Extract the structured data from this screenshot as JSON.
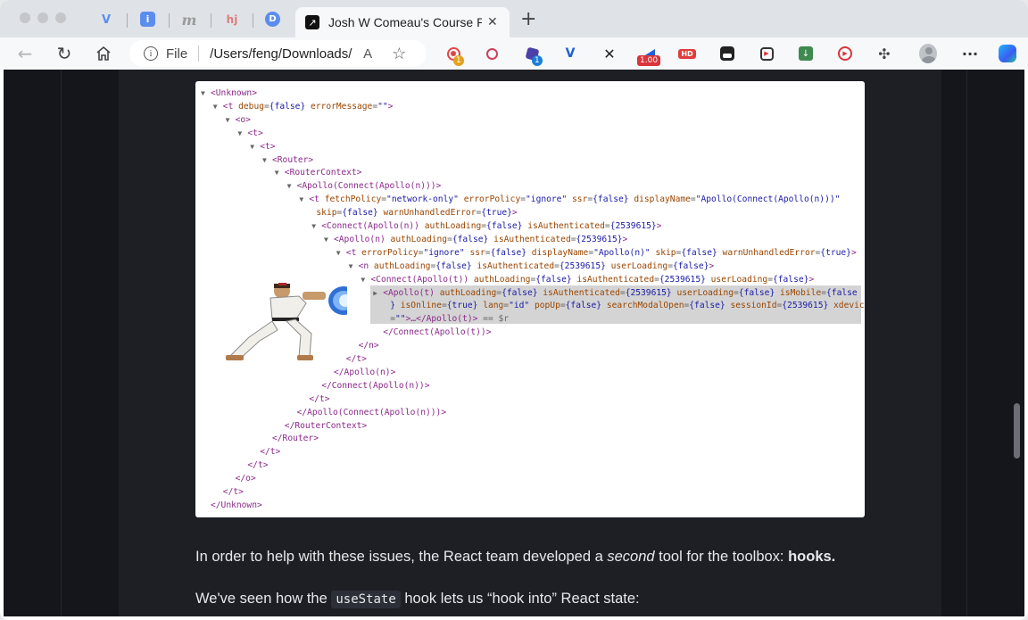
{
  "tabs": {
    "pinned": [
      {
        "icon": "vue-icon",
        "glyph": "V",
        "color": "#5b8def"
      },
      {
        "icon": "info-icon",
        "glyph": "i",
        "color": "#5b8def"
      },
      {
        "icon": "m-icon",
        "glyph": "m",
        "color": "#9a9a9a"
      },
      {
        "icon": "hj-icon",
        "glyph": "hj",
        "color": "#e07a7a"
      },
      {
        "icon": "play-d-icon",
        "glyph": "D",
        "color": "#5b8def"
      }
    ],
    "active": {
      "title": "Josh W Comeau's Course Platform",
      "close": "✕",
      "favicon": "↗"
    },
    "new_tab": "+"
  },
  "toolbar": {
    "back": "←",
    "refresh": "↻",
    "home": "⌂",
    "omnibox": {
      "scheme": "File",
      "url": "/Users/feng/Downloads/",
      "info": "i"
    },
    "read_aloud": "A",
    "favorite": "☆",
    "ext_badges": {
      "first": "1",
      "purple": "1",
      "speed": "1.00"
    },
    "ext_hd": "HD",
    "more": "···"
  },
  "colors": {
    "accent": "#1a73e8",
    "page_bg": "#15161b",
    "content_bg": "#1d1f25"
  },
  "code_lines": [
    {
      "i": 0,
      "arrow": "▼",
      "parts": [
        [
          "tg",
          "<Unknown>"
        ]
      ]
    },
    {
      "i": 1,
      "arrow": "▼",
      "parts": [
        [
          "tg",
          "<t "
        ],
        [
          "at",
          "debug"
        ],
        [
          "ar",
          "="
        ],
        [
          "vl",
          "{false}"
        ],
        [
          "ar",
          " "
        ],
        [
          "at",
          "errorMessage"
        ],
        [
          "ar",
          "="
        ],
        [
          "vl",
          "\"\""
        ],
        [
          "tg",
          ">"
        ]
      ]
    },
    {
      "i": 2,
      "arrow": "▼",
      "parts": [
        [
          "tg",
          "<o>"
        ]
      ]
    },
    {
      "i": 3,
      "arrow": "▼",
      "parts": [
        [
          "tg",
          "<t>"
        ]
      ]
    },
    {
      "i": 4,
      "arrow": "▼",
      "parts": [
        [
          "tg",
          "<t>"
        ]
      ]
    },
    {
      "i": 5,
      "arrow": "▼",
      "parts": [
        [
          "tg",
          "<Router>"
        ]
      ]
    },
    {
      "i": 6,
      "arrow": "▼",
      "parts": [
        [
          "tg",
          "<RouterContext>"
        ]
      ]
    },
    {
      "i": 7,
      "arrow": "▼",
      "parts": [
        [
          "tg",
          "<Apollo(Connect(Apollo(n)))>"
        ]
      ]
    },
    {
      "i": 8,
      "arrow": "▼",
      "parts": [
        [
          "tg",
          "<t "
        ],
        [
          "at",
          "fetchPolicy"
        ],
        [
          "ar",
          "="
        ],
        [
          "vl",
          "\"network-only\""
        ],
        [
          "ar",
          " "
        ],
        [
          "at",
          "errorPolicy"
        ],
        [
          "ar",
          "="
        ],
        [
          "vl",
          "\"ignore\""
        ],
        [
          "ar",
          " "
        ],
        [
          "at",
          "ssr"
        ],
        [
          "ar",
          "="
        ],
        [
          "vl",
          "{false}"
        ],
        [
          "ar",
          " "
        ],
        [
          "at",
          "displayName"
        ],
        [
          "ar",
          "="
        ],
        [
          "vl",
          "\"Apollo(Connect(Apollo(n)))\""
        ]
      ]
    },
    {
      "i": 8,
      "arrow": "",
      "cont": true,
      "parts": [
        [
          "at",
          "skip"
        ],
        [
          "ar",
          "="
        ],
        [
          "vl",
          "{false}"
        ],
        [
          "ar",
          " "
        ],
        [
          "at",
          "warnUnhandledError"
        ],
        [
          "ar",
          "="
        ],
        [
          "vl",
          "{true}"
        ],
        [
          "tg",
          ">"
        ]
      ]
    },
    {
      "i": 9,
      "arrow": "▼",
      "parts": [
        [
          "tg",
          "<Connect(Apollo(n)) "
        ],
        [
          "at",
          "authLoading"
        ],
        [
          "ar",
          "="
        ],
        [
          "vl",
          "{false}"
        ],
        [
          "ar",
          " "
        ],
        [
          "at",
          "isAuthenticated"
        ],
        [
          "ar",
          "="
        ],
        [
          "vl",
          "{2539615}"
        ],
        [
          "tg",
          ">"
        ]
      ]
    },
    {
      "i": 10,
      "arrow": "▼",
      "parts": [
        [
          "tg",
          "<Apollo(n) "
        ],
        [
          "at",
          "authLoading"
        ],
        [
          "ar",
          "="
        ],
        [
          "vl",
          "{false}"
        ],
        [
          "ar",
          " "
        ],
        [
          "at",
          "isAuthenticated"
        ],
        [
          "ar",
          "="
        ],
        [
          "vl",
          "{2539615}"
        ],
        [
          "tg",
          ">"
        ]
      ]
    },
    {
      "i": 11,
      "arrow": "▼",
      "parts": [
        [
          "tg",
          "<t "
        ],
        [
          "at",
          "errorPolicy"
        ],
        [
          "ar",
          "="
        ],
        [
          "vl",
          "\"ignore\""
        ],
        [
          "ar",
          " "
        ],
        [
          "at",
          "ssr"
        ],
        [
          "ar",
          "="
        ],
        [
          "vl",
          "{false}"
        ],
        [
          "ar",
          " "
        ],
        [
          "at",
          "displayName"
        ],
        [
          "ar",
          "="
        ],
        [
          "vl",
          "\"Apollo(n)\""
        ],
        [
          "ar",
          " "
        ],
        [
          "at",
          "skip"
        ],
        [
          "ar",
          "="
        ],
        [
          "vl",
          "{false}"
        ],
        [
          "ar",
          " "
        ],
        [
          "at",
          "warnUnhandledError"
        ],
        [
          "ar",
          "="
        ],
        [
          "vl",
          "{true}"
        ],
        [
          "tg",
          ">"
        ]
      ]
    },
    {
      "i": 12,
      "arrow": "▼",
      "parts": [
        [
          "tg",
          "<n "
        ],
        [
          "at",
          "authLoading"
        ],
        [
          "ar",
          "="
        ],
        [
          "vl",
          "{false}"
        ],
        [
          "ar",
          " "
        ],
        [
          "at",
          "isAuthenticated"
        ],
        [
          "ar",
          "="
        ],
        [
          "vl",
          "{2539615}"
        ],
        [
          "ar",
          " "
        ],
        [
          "at",
          "userLoading"
        ],
        [
          "ar",
          "="
        ],
        [
          "vl",
          "{false}"
        ],
        [
          "tg",
          ">"
        ]
      ]
    },
    {
      "i": 13,
      "arrow": "▼",
      "parts": [
        [
          "tg",
          "<Connect(Apollo(t)) "
        ],
        [
          "at",
          "authLoading"
        ],
        [
          "ar",
          "="
        ],
        [
          "vl",
          "{false}"
        ],
        [
          "ar",
          " "
        ],
        [
          "at",
          "isAuthenticated"
        ],
        [
          "ar",
          "="
        ],
        [
          "vl",
          "{2539615}"
        ],
        [
          "ar",
          " "
        ],
        [
          "at",
          "userLoading"
        ],
        [
          "ar",
          "="
        ],
        [
          "vl",
          "{false}"
        ],
        [
          "tg",
          ">"
        ]
      ]
    },
    {
      "i": 14,
      "arrow": "▶",
      "parts": [
        [
          "tg",
          "<Apollo(t) "
        ],
        [
          "at",
          "authLoading"
        ],
        [
          "ar",
          "="
        ],
        [
          "vl",
          "{false}"
        ],
        [
          "ar",
          " "
        ],
        [
          "at",
          "isAuthenticated"
        ],
        [
          "ar",
          "="
        ],
        [
          "vl",
          "{2539615}"
        ],
        [
          "ar",
          " "
        ],
        [
          "at",
          "userLoading"
        ],
        [
          "ar",
          "="
        ],
        [
          "vl",
          "{false}"
        ],
        [
          "ar",
          " "
        ],
        [
          "at",
          "isMobile"
        ],
        [
          "ar",
          "="
        ],
        [
          "vl",
          "{false"
        ]
      ]
    },
    {
      "i": 14,
      "arrow": "",
      "cont": true,
      "parts": [
        [
          "vl",
          "}"
        ],
        [
          "ar",
          " "
        ],
        [
          "at",
          "isOnline"
        ],
        [
          "ar",
          "="
        ],
        [
          "vl",
          "{true}"
        ],
        [
          "ar",
          " "
        ],
        [
          "at",
          "lang"
        ],
        [
          "ar",
          "="
        ],
        [
          "vl",
          "\"id\""
        ],
        [
          "ar",
          " "
        ],
        [
          "at",
          "popUp"
        ],
        [
          "ar",
          "="
        ],
        [
          "vl",
          "{false}"
        ],
        [
          "ar",
          " "
        ],
        [
          "at",
          "searchModalOpen"
        ],
        [
          "ar",
          "="
        ],
        [
          "vl",
          "{false}"
        ],
        [
          "ar",
          " "
        ],
        [
          "at",
          "sessionId"
        ],
        [
          "ar",
          "="
        ],
        [
          "vl",
          "{2539615}"
        ],
        [
          "ar",
          " "
        ],
        [
          "at",
          "xdevice"
        ]
      ]
    },
    {
      "i": 14,
      "arrow": "",
      "cont": true,
      "parts": [
        [
          "ar",
          "="
        ],
        [
          "vl",
          "\"\""
        ],
        [
          "tg",
          ">…</Apollo(t)>"
        ],
        [
          "ar",
          " == $r"
        ]
      ]
    },
    {
      "i": 14,
      "arrow": "",
      "parts": [
        [
          "tg",
          "</Connect(Apollo(t))>"
        ]
      ]
    },
    {
      "i": 12,
      "arrow": "",
      "parts": [
        [
          "tg",
          "</n>"
        ]
      ]
    },
    {
      "i": 11,
      "arrow": "",
      "parts": [
        [
          "tg",
          "</t>"
        ]
      ]
    },
    {
      "i": 10,
      "arrow": "",
      "parts": [
        [
          "tg",
          "</Apollo(n)>"
        ]
      ]
    },
    {
      "i": 9,
      "arrow": "",
      "parts": [
        [
          "tg",
          "</Connect(Apollo(n))>"
        ]
      ]
    },
    {
      "i": 8,
      "arrow": "",
      "parts": [
        [
          "tg",
          "</t>"
        ]
      ]
    },
    {
      "i": 7,
      "arrow": "",
      "parts": [
        [
          "tg",
          "</Apollo(Connect(Apollo(n)))>"
        ]
      ]
    },
    {
      "i": 6,
      "arrow": "",
      "parts": [
        [
          "tg",
          "</RouterContext>"
        ]
      ]
    },
    {
      "i": 5,
      "arrow": "",
      "parts": [
        [
          "tg",
          "</Router>"
        ]
      ]
    },
    {
      "i": 4,
      "arrow": "",
      "parts": [
        [
          "tg",
          "</t>"
        ]
      ]
    },
    {
      "i": 3,
      "arrow": "",
      "parts": [
        [
          "tg",
          "</t>"
        ]
      ]
    },
    {
      "i": 2,
      "arrow": "",
      "parts": [
        [
          "tg",
          "</o>"
        ]
      ]
    },
    {
      "i": 1,
      "arrow": "",
      "parts": [
        [
          "tg",
          "</t>"
        ]
      ]
    },
    {
      "i": 0,
      "arrow": "",
      "parts": [
        [
          "tg",
          "</Unknown>"
        ]
      ]
    }
  ],
  "article": {
    "p1_before": "In order to help with these issues, the React team developed a ",
    "p1_em": "second",
    "p1_mid": " tool for the toolbox: ",
    "p1_bold": "hooks.",
    "p2_before": "We've seen how the ",
    "p2_code": "useState",
    "p2_after": " hook lets us “hook into” React state:"
  }
}
